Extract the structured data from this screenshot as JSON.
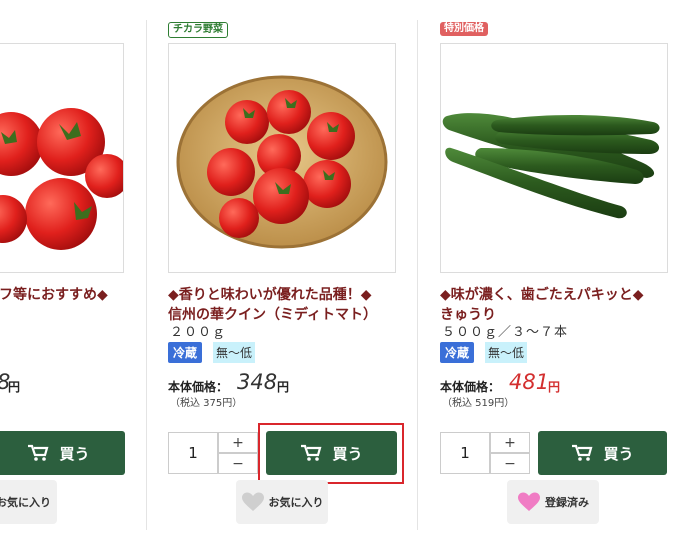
{
  "left": {
    "title": "フ等におすすめ◆",
    "price_partial": "8",
    "yen": "円",
    "buy_label": "買う",
    "fav_label": "お気に入り"
  },
  "middle": {
    "badge": "チカラ野菜",
    "title_line1": "◆香りと味わいが優れた品種！◆",
    "title_line2": "信州の華クイン（ミディトマト）",
    "sub": "２００ｇ",
    "tag_cold": "冷蔵",
    "tag_low": "無〜低",
    "price_label": "本体価格：",
    "price": "348",
    "yen": "円",
    "tax_incl": "（税込 375円）",
    "qty": "1",
    "plus": "+",
    "minus": "−",
    "buy_label": "買う",
    "fav_label": "お気に入り"
  },
  "right": {
    "badge": "特別価格",
    "title_line1": "◆味が濃く、歯ごたえパキッと◆",
    "title_line2": "きゅうり",
    "sub": "５００ｇ／３〜７本",
    "tag_cold": "冷蔵",
    "tag_low": "無〜低",
    "price_label": "本体価格：",
    "price": "481",
    "yen": "円",
    "tax_incl": "（税込 519円）",
    "qty": "1",
    "plus": "+",
    "minus": "−",
    "buy_label": "買う",
    "fav_label": "登録済み"
  },
  "icons": [
    "cart-icon",
    "heart-icon",
    "tomato-image",
    "cucumber-image"
  ],
  "colors": {
    "button_green": "#2c5f3e",
    "title_red": "#7a1f1f",
    "price_red": "#d32f2f",
    "cold_blue": "#3a6fd8",
    "highlight": "#d9262c",
    "fav_pink": "#f07cc4"
  }
}
